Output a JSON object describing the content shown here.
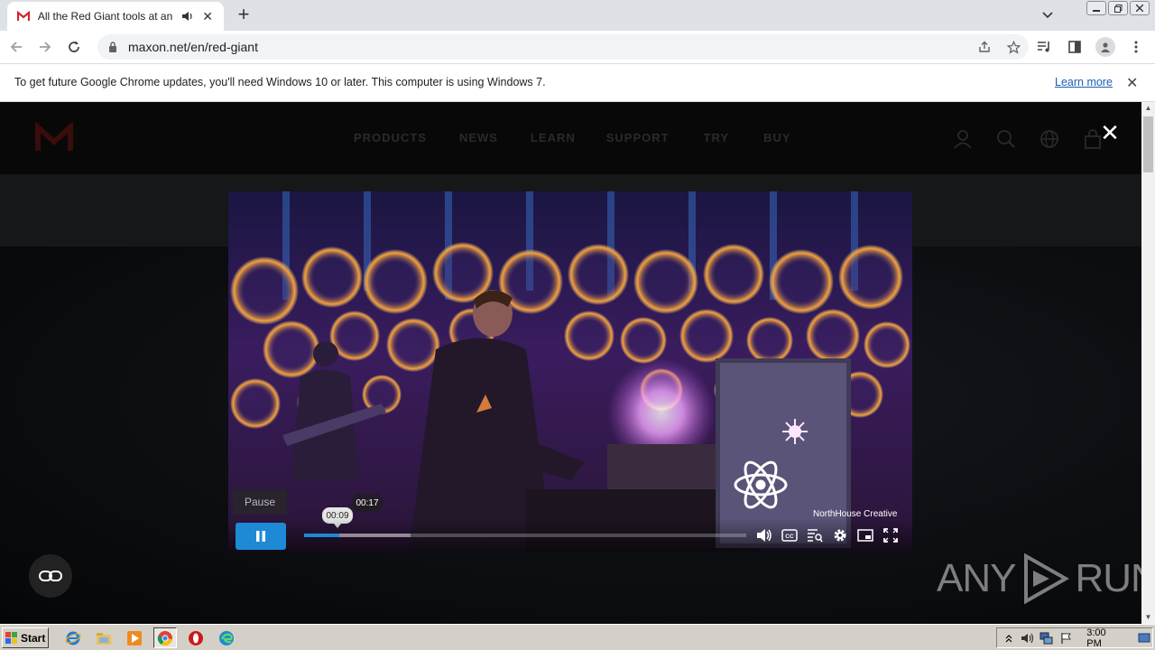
{
  "browser": {
    "tab": {
      "title": "All the Red Giant tools at an affordable price",
      "close_label": "✕"
    },
    "new_tab_label": "+",
    "address": {
      "url": "maxon.net/en/red-giant"
    }
  },
  "infobar": {
    "message": "To get future Google Chrome updates, you'll need Windows 10 or later. This computer is using Windows 7.",
    "link_label": "Learn more",
    "close_label": "✕"
  },
  "site": {
    "nav": [
      "PRODUCTS",
      "NEWS",
      "LEARN",
      "SUPPORT",
      "TRY",
      "BUY"
    ],
    "modal_close": "✕"
  },
  "video": {
    "credit": "NorthHouse Creative",
    "pause_tooltip": "Pause",
    "hover_time": "00:17",
    "current_time": "00:09",
    "progress_fraction": 0.08,
    "buffered_fraction": 0.24,
    "accent_color": "#1e8ad6"
  },
  "watermark": {
    "text_left": "ANY",
    "text_right": "RUN"
  },
  "taskbar": {
    "start_label": "Start",
    "apps": [
      "ie-icon",
      "explorer-icon",
      "media-player-icon",
      "chrome-icon",
      "opera-icon",
      "edge-icon"
    ],
    "clock": "3:00 PM"
  }
}
